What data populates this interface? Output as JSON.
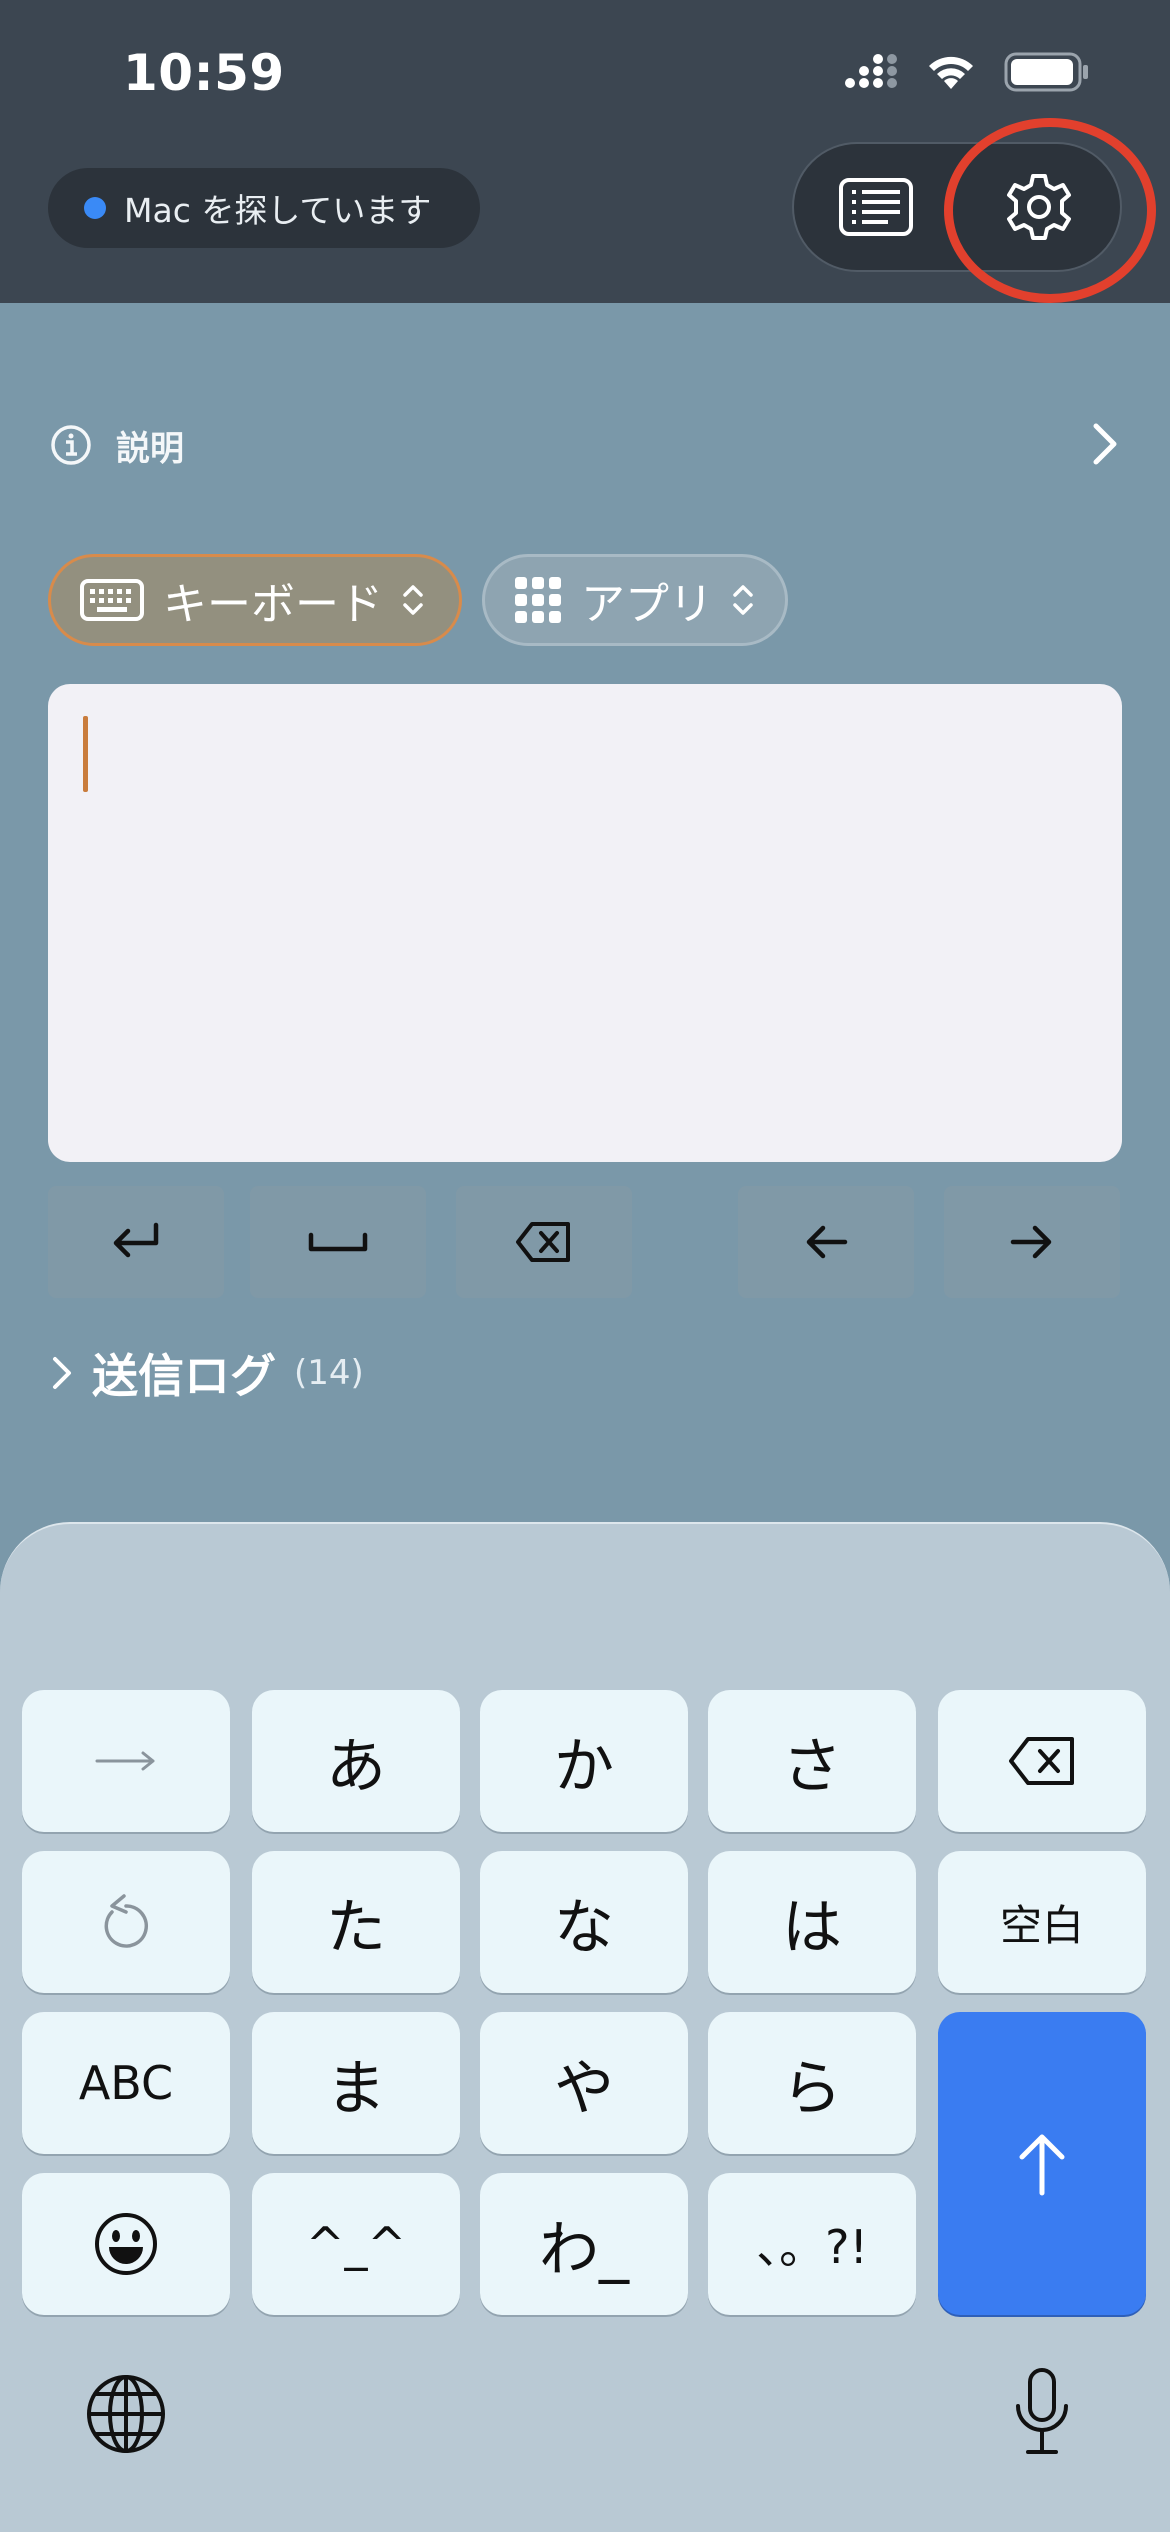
{
  "status_bar": {
    "time": "10:59"
  },
  "header": {
    "connection_status": "Mac を探しています",
    "accent_color": "#e2402d"
  },
  "info": {
    "label": "説明"
  },
  "mode": {
    "keyboard_label": "キーボード",
    "app_label": "アプリ"
  },
  "text_input": {
    "value": ""
  },
  "log": {
    "label": "送信ログ",
    "count": "(14)"
  },
  "keyboard": {
    "row1": [
      "→",
      "あ",
      "か",
      "さ",
      "⌫"
    ],
    "row2": [
      "↺",
      "た",
      "な",
      "は",
      "空白"
    ],
    "row3": [
      "ABC",
      "ま",
      "や",
      "ら"
    ],
    "row4": [
      "☺",
      "^_^",
      "わ_",
      "、。?!"
    ],
    "send_color": "#3a7cf1",
    "space_label": "空白",
    "abc_label": "ABC",
    "face_label": "^_^",
    "wa_label": "わ_",
    "punct_label": "、。?!"
  }
}
